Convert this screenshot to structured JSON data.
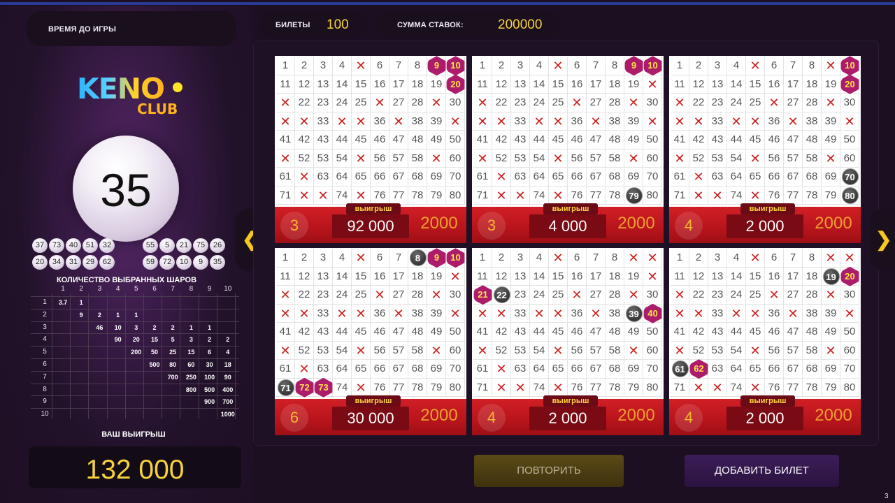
{
  "header": {
    "timer_label": "ВРЕМЯ ДО ИГРЫ",
    "tickets_label": "БИЛЕТЫ",
    "tickets_value": "100",
    "bets_label": "СУММА СТАВОК:",
    "bets_value": "200000"
  },
  "logo": {
    "line1": "KENO",
    "line2": "CLUB"
  },
  "current_ball": "35",
  "drawn_balls": [
    "37",
    "73",
    "40",
    "51",
    "32",
    "55",
    "5",
    "21",
    "75",
    "26",
    "20",
    "34",
    "31",
    "29",
    "62",
    "59",
    "72",
    "10",
    "9",
    "35"
  ],
  "prize_table": {
    "title": "КОЛИЧЕСТВО ВЫБРАННЫХ ШАРОВ",
    "columns": [
      "1",
      "2",
      "3",
      "4",
      "5",
      "6",
      "7",
      "8",
      "9",
      "10"
    ],
    "rows": [
      {
        "label": "1",
        "cells": [
          "3.7",
          "1",
          "",
          "",
          "",
          "",
          "",
          "",
          "",
          ""
        ]
      },
      {
        "label": "2",
        "cells": [
          "",
          "9",
          "2",
          "1",
          "1",
          "",
          "",
          "",
          "",
          ""
        ]
      },
      {
        "label": "3",
        "cells": [
          "",
          "",
          "46",
          "10",
          "3",
          "2",
          "2",
          "1",
          "1",
          ""
        ]
      },
      {
        "label": "4",
        "cells": [
          "",
          "",
          "",
          "90",
          "20",
          "15",
          "5",
          "3",
          "2",
          "2"
        ]
      },
      {
        "label": "5",
        "cells": [
          "",
          "",
          "",
          "",
          "200",
          "50",
          "25",
          "15",
          "6",
          "4"
        ]
      },
      {
        "label": "6",
        "cells": [
          "",
          "",
          "",
          "",
          "",
          "500",
          "80",
          "60",
          "30",
          "18"
        ]
      },
      {
        "label": "7",
        "cells": [
          "",
          "",
          "",
          "",
          "",
          "",
          "700",
          "250",
          "100",
          "90"
        ]
      },
      {
        "label": "8",
        "cells": [
          "",
          "",
          "",
          "",
          "",
          "",
          "",
          "800",
          "500",
          "400"
        ]
      },
      {
        "label": "9",
        "cells": [
          "",
          "",
          "",
          "",
          "",
          "",
          "",
          "",
          "900",
          "700"
        ]
      },
      {
        "label": "10",
        "cells": [
          "",
          "",
          "",
          "",
          "",
          "",
          "",
          "",
          "",
          "1000"
        ]
      }
    ]
  },
  "win": {
    "label": "ВАШ ВЫИГРЫШ",
    "value": "132 000"
  },
  "crossed": [
    5,
    10,
    20,
    21,
    26,
    29,
    31,
    32,
    34,
    35,
    37,
    40,
    51,
    55,
    59,
    62,
    72,
    73,
    75,
    9
  ],
  "tickets": [
    {
      "hits": "3",
      "win_label": "выигрыш",
      "win": "92 000",
      "bet": "2000",
      "marks": [
        {
          "n": 9,
          "t": "h"
        },
        {
          "n": 10,
          "t": "h"
        },
        {
          "n": 20,
          "t": "h"
        }
      ]
    },
    {
      "hits": "3",
      "win_label": "выигрыш",
      "win": "4 000",
      "bet": "2000",
      "marks": [
        {
          "n": 9,
          "t": "h"
        },
        {
          "n": 10,
          "t": "h"
        },
        {
          "n": 79,
          "t": "b"
        }
      ]
    },
    {
      "hits": "4",
      "win_label": "выигрыш",
      "win": "2 000",
      "bet": "2000",
      "marks": [
        {
          "n": 10,
          "t": "h"
        },
        {
          "n": 20,
          "t": "h"
        },
        {
          "n": 70,
          "t": "b"
        },
        {
          "n": 80,
          "t": "b"
        }
      ]
    },
    {
      "hits": "6",
      "win_label": "выигрыш",
      "win": "30 000",
      "bet": "2000",
      "marks": [
        {
          "n": 8,
          "t": "b"
        },
        {
          "n": 9,
          "t": "h"
        },
        {
          "n": 10,
          "t": "h"
        },
        {
          "n": 71,
          "t": "b"
        },
        {
          "n": 72,
          "t": "h"
        },
        {
          "n": 73,
          "t": "h"
        }
      ]
    },
    {
      "hits": "4",
      "win_label": "выигрыш",
      "win": "2 000",
      "bet": "2000",
      "marks": [
        {
          "n": 21,
          "t": "h"
        },
        {
          "n": 22,
          "t": "b"
        },
        {
          "n": 39,
          "t": "b"
        },
        {
          "n": 40,
          "t": "h"
        }
      ]
    },
    {
      "hits": "4",
      "win_label": "выигрыш",
      "win": "2 000",
      "bet": "2000",
      "marks": [
        {
          "n": 19,
          "t": "b"
        },
        {
          "n": 20,
          "t": "h"
        },
        {
          "n": 61,
          "t": "b"
        },
        {
          "n": 62,
          "t": "h"
        }
      ]
    }
  ],
  "buttons": {
    "repeat": "ПОВТОРИТЬ",
    "add_ticket": "ДОБАВИТЬ БИЛЕТ",
    "prev": "❮",
    "next": "❯"
  },
  "corner_text": "3"
}
